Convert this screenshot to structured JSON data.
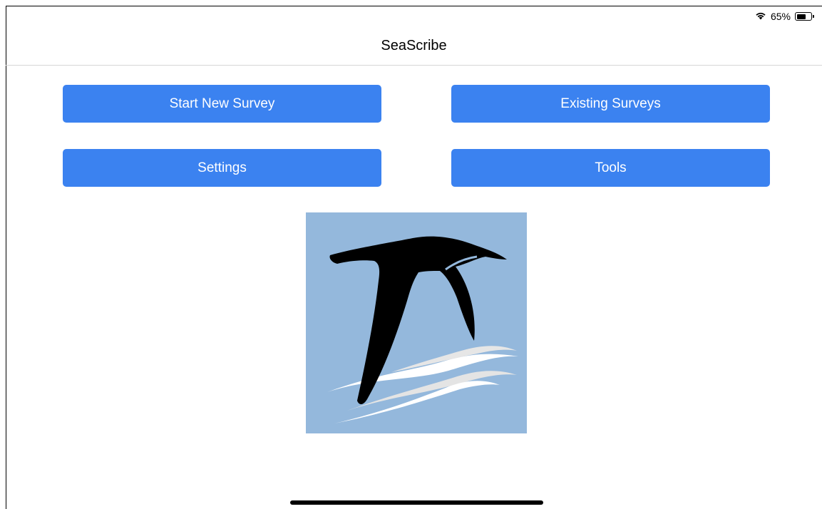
{
  "status_bar": {
    "battery_percent": "65%",
    "battery_level": 0.65,
    "icons": [
      "wifi-icon",
      "battery-icon"
    ]
  },
  "nav": {
    "title": "SeaScribe"
  },
  "buttons": {
    "start_new_survey": "Start New Survey",
    "existing_surveys": "Existing Surveys",
    "settings": "Settings",
    "tools": "Tools"
  },
  "logo": {
    "icon": "seabird-logo",
    "background": "#94b8dc"
  },
  "colors": {
    "accent": "#3b82f0"
  }
}
